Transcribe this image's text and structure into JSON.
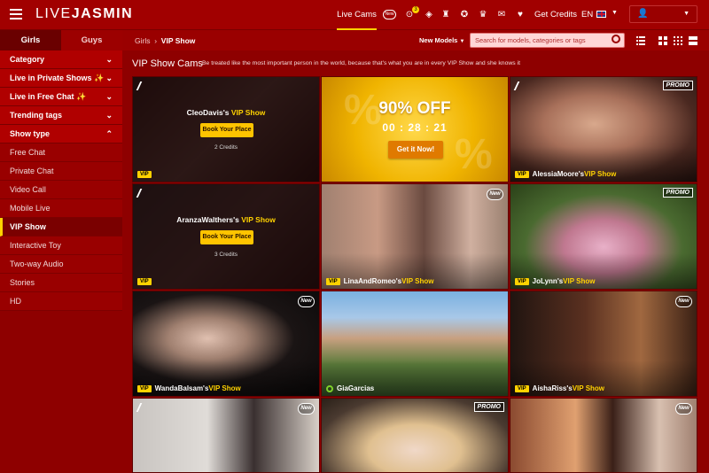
{
  "header": {
    "logo_left": "LIVE",
    "logo_right": "JASMIN",
    "nav_active": "Live Cams",
    "new_pill": "New",
    "notif_count": "3",
    "get_credits": "Get Credits",
    "language": "EN"
  },
  "sidebar": {
    "tab_girls": "Girls",
    "tab_guys": "Guys",
    "sections": [
      {
        "label": "Category"
      },
      {
        "label": "Live in Private Shows ✨"
      },
      {
        "label": "Live in Free Chat ✨"
      },
      {
        "label": "Trending tags"
      },
      {
        "label": "Show type"
      }
    ],
    "items": [
      {
        "label": "Free Chat"
      },
      {
        "label": "Private Chat"
      },
      {
        "label": "Video Call"
      },
      {
        "label": "Mobile Live"
      },
      {
        "label": "VIP Show"
      },
      {
        "label": "Interactive Toy"
      },
      {
        "label": "Two-way Audio"
      },
      {
        "label": "Stories"
      },
      {
        "label": "HD"
      }
    ]
  },
  "subheader": {
    "crumb_root": "Girls",
    "crumb_sep": "›",
    "crumb_current": "VIP Show",
    "sort_label": "New Models",
    "search_placeholder": "Search for models, categories or tags"
  },
  "main": {
    "title": "VIP Show Cams",
    "description": "Be treated like the most important person in the world, because that's what you are in every VIP Show and she knows it",
    "vip_badge": "VIP",
    "vip_show_suffix": " VIP Show",
    "book_label": "Book Your Place",
    "new_badge": "New",
    "promo_badge": "PROMO",
    "promo": {
      "off": "90% OFF",
      "timer": "00 : 28 : 21",
      "cta": "Get it Now!"
    },
    "tiles": [
      {
        "name": "CleoDavis's",
        "credits": "2 Credits"
      },
      {
        "name": "AlessiaMoore's"
      },
      {
        "name": "AranzaWalthers's",
        "credits": "3 Credits"
      },
      {
        "name": "LinaAndRomeo's"
      },
      {
        "name": "JoLynn's"
      },
      {
        "name": "WandaBalsam's"
      },
      {
        "name": "GiaGarcias"
      },
      {
        "name": "AishaRiss's"
      }
    ]
  },
  "colors": {
    "brand_red": "#a10000",
    "accent_yellow": "#ffd200"
  }
}
